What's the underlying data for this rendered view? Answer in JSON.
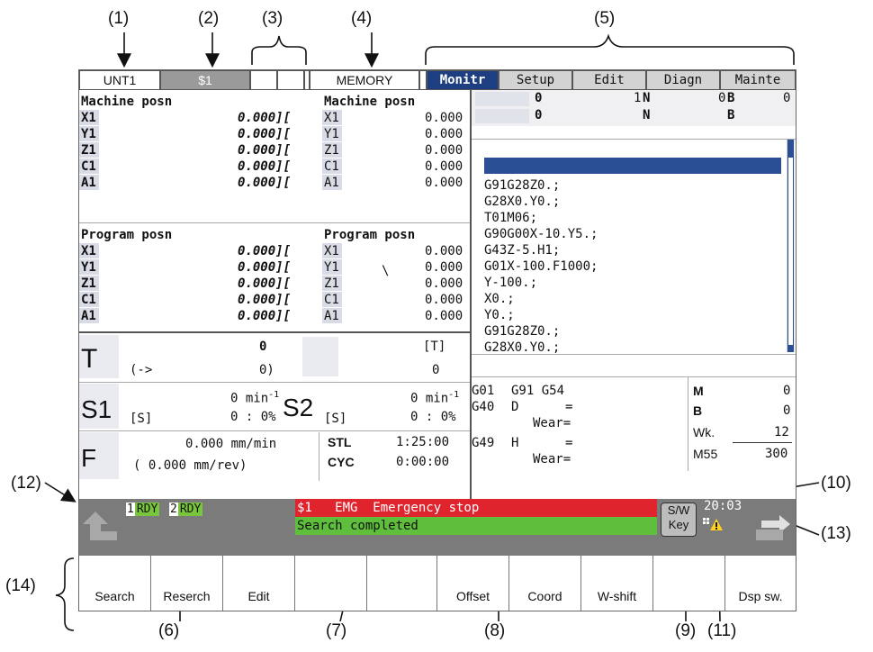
{
  "callouts": {
    "c1": "(1)",
    "c2": "(2)",
    "c3": "(3)",
    "c4": "(4)",
    "c5": "(5)",
    "c6": "(6)",
    "c7": "(7)",
    "c8": "(8)",
    "c9": "(9)",
    "c10": "(10)",
    "c11": "(11)",
    "c12": "(12)",
    "c13": "(13)",
    "c14": "(14)"
  },
  "top_bar": {
    "unit": "UNT1",
    "system": "$1",
    "blank1": "",
    "blank2": "",
    "mode": "MEMORY",
    "tabs": [
      "Monitr",
      "Setup",
      "Edit",
      "Diagn",
      "Mainte"
    ]
  },
  "machine_left": {
    "title": "Machine posn",
    "axes": [
      "X1",
      "Y1",
      "Z1",
      "C1",
      "A1"
    ],
    "values": [
      "0.000][",
      "0.000][",
      "0.000][",
      "0.000][",
      "0.000]["
    ]
  },
  "machine_right": {
    "title": "Machine posn",
    "axes": [
      "X1",
      "Y1",
      "Z1",
      "C1",
      "A1"
    ],
    "values": [
      "0.000",
      "0.000",
      "0.000",
      "0.000",
      "0.000"
    ]
  },
  "program_left": {
    "title": "Program posn",
    "axes": [
      "X1",
      "Y1",
      "Z1",
      "C1",
      "A1"
    ],
    "values": [
      "0.000][",
      "0.000][",
      "0.000][",
      "0.000][",
      "0.000]["
    ]
  },
  "program_right": {
    "title": "Program posn",
    "axes": [
      "X1",
      "Y1",
      "Z1",
      "C1",
      "A1"
    ],
    "values": [
      "0.000",
      "0.000",
      "0.000",
      "0.000",
      "0.000"
    ],
    "mark": "\\"
  },
  "tool": {
    "label": "T",
    "value": "0",
    "arrow": "(->",
    "paren": "0)",
    "bracket_t": "[T]",
    "bracket_val": "0"
  },
  "spindle": {
    "s1": "S1",
    "s1_unit": "0 min",
    "s1_exp": "-1",
    "s1_s": "[S]",
    "s1_pct": "0 :  0%",
    "s2": "S2",
    "s2_unit": "0 min",
    "s2_exp": "-1",
    "s2_s": "[S]",
    "s2_pct": "0 :  0%"
  },
  "feed": {
    "label": "F",
    "line1": "0.000 mm/min",
    "line2": "( 0.000   mm/rev)",
    "stl_label": "STL",
    "stl_value": "1:25:00",
    "cyc_label": "CYC",
    "cyc_value": "0:00:00"
  },
  "program_header": {
    "o1": "0",
    "n1_val": "1",
    "n1": "N",
    "b1_pre": "0",
    "b1": "B",
    "b1_val": "0",
    "o2": "0",
    "n2": "N",
    "b2": "B"
  },
  "program_lines": [
    "G91G28Z0.;",
    "G28X0.Y0.;",
    "T01M06;",
    "G90G00X-10.Y5.;",
    "G43Z-5.H1;",
    "G01X-100.F1000;",
    "Y-100.;",
    "X0.;",
    "Y0.;",
    "G91G28Z0.;",
    "G28X0.Y0.;"
  ],
  "modal": {
    "g1": "G01",
    "g1b": "G91 G54",
    "g2": "G40",
    "d": "D",
    "eq1": "=",
    "wear1": "Wear=",
    "g3": "G49",
    "h": "H",
    "eq2": "=",
    "wear2": "Wear=",
    "m_label": "M",
    "m_val": "0",
    "b_label": "B",
    "b_val": "0",
    "wk_label": "Wk.",
    "wk_val": "12",
    "m55_label": "M55",
    "m55_val": "300"
  },
  "status": {
    "rdy1_num": "1",
    "rdy1": "RDY",
    "rdy2_num": "2",
    "rdy2": "RDY",
    "alarm": "$1   EMG  Emergency stop",
    "message": "Search completed",
    "sw_key_line1": "S/W",
    "sw_key_line2": "Key",
    "time": "20:03"
  },
  "softkeys": [
    "Search",
    "Reserch",
    "Edit",
    "",
    "",
    "Offset",
    "Coord",
    "W-shift",
    "",
    "Dsp sw."
  ],
  "colors": {
    "tab_active": "#1d3f82",
    "alarm_red": "#e0242d",
    "message_green": "#5fbf3c",
    "rdy_green": "#78c63c",
    "program_highlight": "#2a4f94",
    "status_bar_bg": "#7b7b7b"
  }
}
